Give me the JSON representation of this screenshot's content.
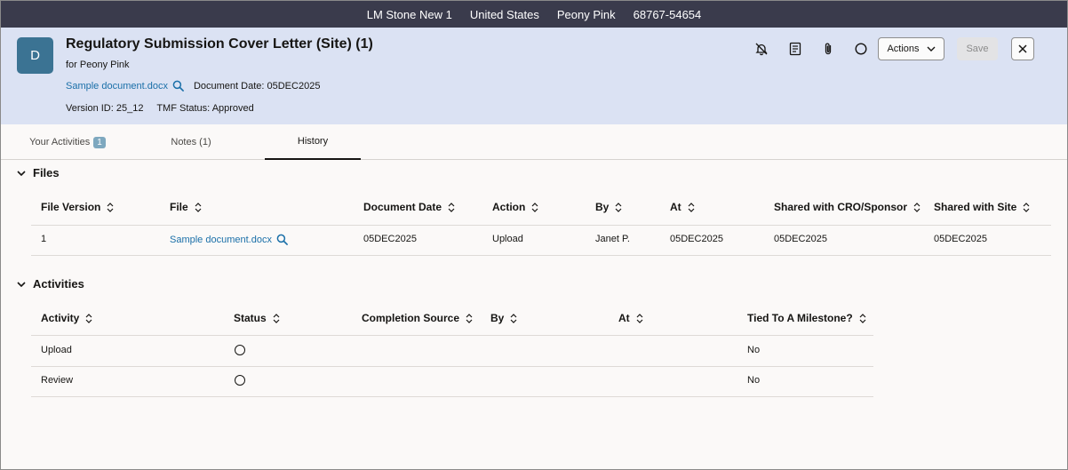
{
  "context_bar": {
    "study": "LM Stone New 1",
    "country": "United States",
    "site": "Peony Pink",
    "site_id": "68767-54654"
  },
  "header": {
    "avatar_letter": "D",
    "title": "Regulatory Submission Cover Letter (Site) (1)",
    "subtitle": "for Peony Pink",
    "file_link": "Sample document.docx",
    "document_date_label": "Document Date:",
    "document_date": "05DEC2025",
    "version_label": "Version ID:",
    "version": "25_12",
    "tmf_label": "TMF Status:",
    "tmf_status": "Approved",
    "actions_label": "Actions",
    "save_label": "Save"
  },
  "tabs": [
    {
      "label": "Your Activities",
      "badge": "1"
    },
    {
      "label": "Notes (1)"
    },
    {
      "label": "History",
      "active": true
    }
  ],
  "files": {
    "section_title": "Files",
    "columns": [
      "File Version",
      "File",
      "Document Date",
      "Action",
      "By",
      "At",
      "Shared with CRO/Sponsor",
      "Shared with Site"
    ],
    "rows": [
      [
        "1",
        "Sample document.docx",
        "05DEC2025",
        "Upload",
        "Janet P.",
        "05DEC2025",
        "05DEC2025",
        "05DEC2025"
      ]
    ]
  },
  "activities": {
    "section_title": "Activities",
    "columns": [
      "Activity",
      "Status",
      "Completion Source",
      "By",
      "At",
      "Tied To A Milestone?"
    ],
    "rows": [
      [
        "Upload",
        "",
        "",
        "",
        "",
        "No"
      ],
      [
        "Review",
        "",
        "",
        "",
        "",
        "No"
      ]
    ]
  }
}
